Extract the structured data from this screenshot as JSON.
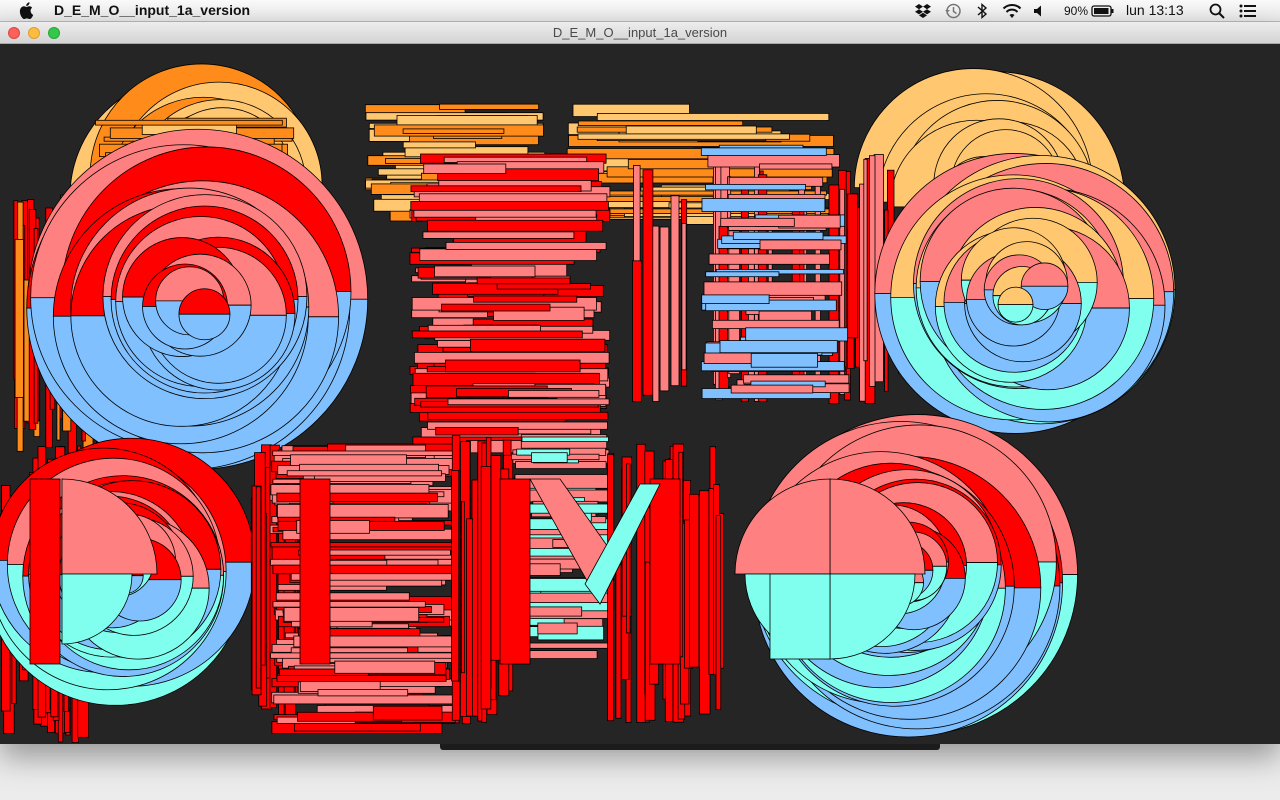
{
  "menubar": {
    "app_name": "D_E_M_O__input_1a_version",
    "battery_percent": "90%",
    "clock": "lun 13:13",
    "status_icons": [
      "dropbox-icon",
      "time-machine-icon",
      "bluetooth-icon",
      "wifi-icon",
      "volume-icon",
      "battery-icon",
      "spotlight-icon",
      "notification-center-icon"
    ]
  },
  "window": {
    "title": "D_E_M_O__input_1a_version"
  },
  "colors": {
    "canvas_bg": "#252525",
    "red": "#ff0000",
    "salmon": "#ff8080",
    "orange": "#ff8c1a",
    "light_orange": "#ffc870",
    "cyan": "#80ffef",
    "light_blue": "#80c0ff"
  },
  "artwork": {
    "word": "DEMO",
    "description_letters": [
      "D",
      "E",
      "M",
      "O"
    ]
  }
}
